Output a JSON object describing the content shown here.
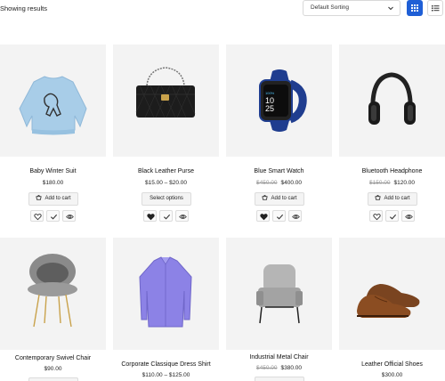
{
  "toolbar": {
    "showing_text": "Showing results",
    "sort_value": "Default Sorting",
    "grid_icon": "grid-view-icon",
    "list_icon": "list-view-icon",
    "accent_color": "#1f5fd6"
  },
  "products": [
    {
      "name": "Baby Winter Suit",
      "old_price": "",
      "price": "$180.00",
      "button": "Add to cart",
      "wishlisted": false
    },
    {
      "name": "Black Leather Purse",
      "old_price": "",
      "price": "$15.00 – $20.00",
      "button": "Select options",
      "wishlisted": true
    },
    {
      "name": "Blue Smart Watch",
      "old_price": "$450.00",
      "price": "$400.00",
      "button": "Add to cart",
      "wishlisted": true
    },
    {
      "name": "Bluetooth Headphone",
      "old_price": "$150.00",
      "price": "$120.00",
      "button": "Add to cart",
      "wishlisted": false
    },
    {
      "name": "Contemporary Swivel Chair",
      "old_price": "",
      "price": "$90.00",
      "button": "",
      "wishlisted": false
    },
    {
      "name": "Corporate Classique Dress Shirt",
      "old_price": "",
      "price": "$110.00 – $125.00",
      "button": "",
      "wishlisted": false
    },
    {
      "name": "Industrial Metal Chair",
      "old_price": "$450.00",
      "price": "$380.00",
      "button": "",
      "wishlisted": false
    },
    {
      "name": "Leather Official Shoes",
      "old_price": "",
      "price": "$300.00",
      "button": "",
      "wishlisted": false
    }
  ]
}
